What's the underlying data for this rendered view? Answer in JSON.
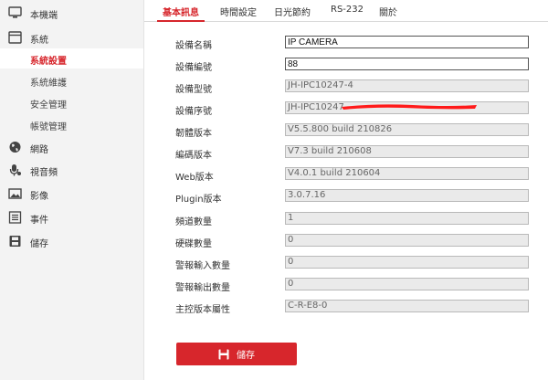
{
  "sidebar": {
    "items": [
      {
        "label": "本機端",
        "icon": "monitor-icon"
      },
      {
        "label": "系統",
        "icon": "system-window-icon"
      },
      {
        "label": "網路",
        "icon": "globe-icon"
      },
      {
        "label": "視音頻",
        "icon": "video-audio-icon"
      },
      {
        "label": "影像",
        "icon": "image-icon"
      },
      {
        "label": "事件",
        "icon": "event-list-icon"
      },
      {
        "label": "儲存",
        "icon": "storage-icon"
      }
    ],
    "system_subitems": [
      {
        "label": "系統設置",
        "active": true
      },
      {
        "label": "系統維護",
        "active": false
      },
      {
        "label": "安全管理",
        "active": false
      },
      {
        "label": "帳號管理",
        "active": false
      }
    ]
  },
  "tabs": [
    {
      "label": "基本訊息",
      "active": true
    },
    {
      "label": "時間設定",
      "active": false
    },
    {
      "label": "日光節約",
      "active": false
    },
    {
      "label": "RS-232",
      "active": false
    },
    {
      "label": "關於",
      "active": false
    }
  ],
  "form": {
    "rows": [
      {
        "label": "設備名稱",
        "value": "IP CAMERA",
        "editable": true
      },
      {
        "label": "設備編號",
        "value": "88",
        "editable": true
      },
      {
        "label": "設備型號",
        "value": "JH-IPC10247-4",
        "editable": false
      },
      {
        "label": "設備序號",
        "value": "JH-IPC10247",
        "editable": false
      },
      {
        "label": "韌體版本",
        "value": "V5.5.800 build 210826",
        "editable": false
      },
      {
        "label": "編碼版本",
        "value": "V7.3 build 210608",
        "editable": false
      },
      {
        "label": "Web版本",
        "value": "V4.0.1 build 210604",
        "editable": false
      },
      {
        "label": "Plugin版本",
        "value": "3.0.7.16",
        "editable": false
      },
      {
        "label": "頻道數量",
        "value": "1",
        "editable": false
      },
      {
        "label": "硬碟數量",
        "value": "0",
        "editable": false
      },
      {
        "label": "警報輸入數量",
        "value": "0",
        "editable": false
      },
      {
        "label": "警報輸出數量",
        "value": "0",
        "editable": false
      },
      {
        "label": "主控版本屬性",
        "value": "C-R-E8-0",
        "editable": false
      }
    ]
  },
  "save_button": {
    "label": "儲存",
    "icon": "save-icon"
  },
  "colors": {
    "accent": "#d7262c",
    "sidebar_bg": "#f3f3f3",
    "readonly_field": "#eaeaea"
  }
}
